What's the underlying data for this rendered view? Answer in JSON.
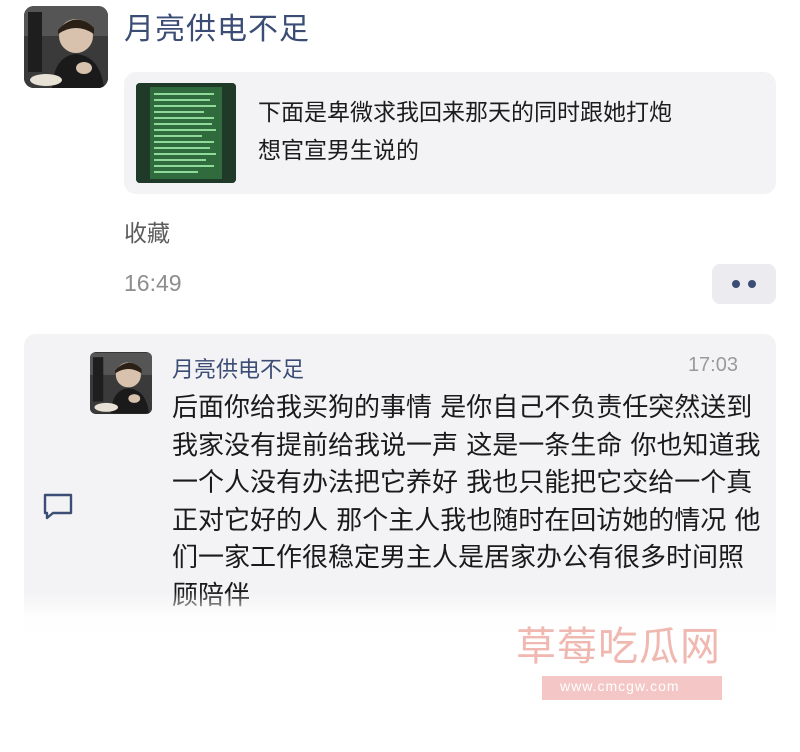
{
  "header": {
    "sender_name": "月亮供电不足"
  },
  "note_card": {
    "line1": "下面是卑微求我回来那天的同时跟她打炮",
    "line2": "想官宣男生说的"
  },
  "collect_label": "收藏",
  "timestamp": "16:49",
  "message_card": {
    "sender_name": "月亮供电不足",
    "time": "17:03",
    "body": "后面你给我买狗的事情 是你自己不负责任突然送到我家没有提前给我说一声 这是一条生命 你也知道我一个人没有办法把它养好 我也只能把它交给一个真正对它好的人 那个主人我也随时在回访她的情况 他们一家工作很稳定男主人是居家办公有很多时间照顾陪伴"
  },
  "watermark": {
    "title": "草莓吃瓜网",
    "url": "www.cmcgw.com"
  },
  "icons": {
    "more": "more-dots-icon",
    "comment": "comment-icon"
  },
  "colors": {
    "name": "#3b4d75",
    "card_bg": "#f3f3f5",
    "watermark": "#f0b8b0"
  }
}
